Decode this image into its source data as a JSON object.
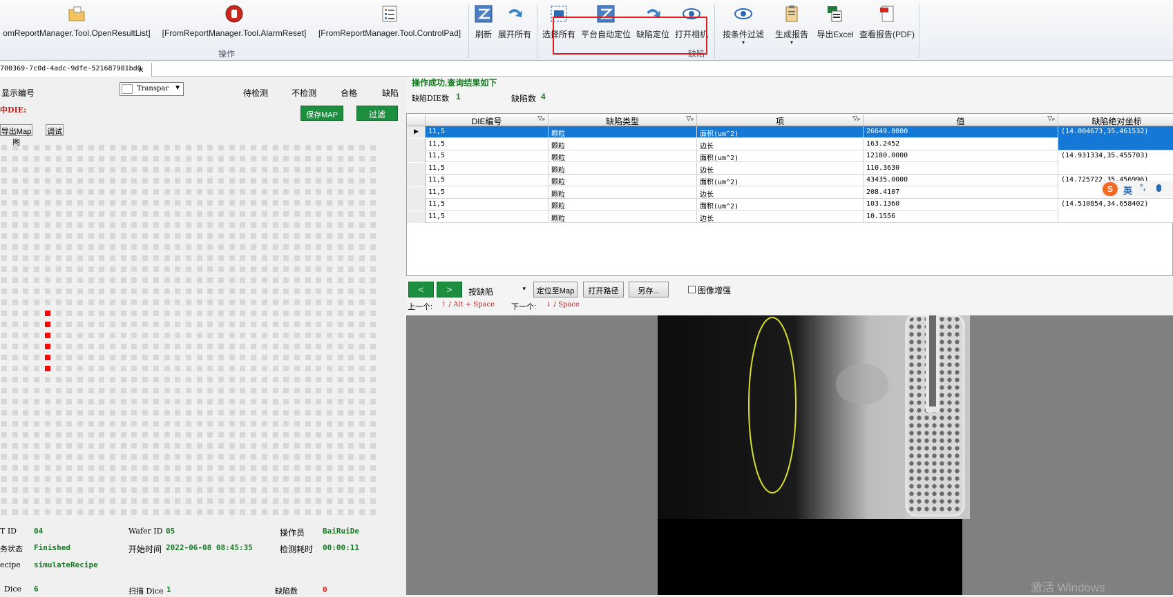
{
  "ribbon": {
    "items": [
      {
        "label": "omReportManager.Tool.OpenResultList]",
        "icon": "folder-icon"
      },
      {
        "label": "[FromReportManager.Tool.AlarmReset]",
        "icon": "stop-hand-icon"
      },
      {
        "label": "[FromReportManager.Tool.ControlPad]",
        "icon": "list-icon"
      },
      {
        "label": "刷新",
        "icon": "refresh-icon"
      },
      {
        "label": "展开所有",
        "icon": "expand-arrow-icon"
      },
      {
        "label": "选择所有",
        "icon": "select-all-icon"
      },
      {
        "label": "平台自动定位",
        "icon": "auto-locate-icon"
      },
      {
        "label": "缺陷定位",
        "icon": "defect-locate-icon"
      },
      {
        "label": "打开相机",
        "icon": "camera-eye-icon"
      },
      {
        "label": "按条件过滤",
        "icon": "filter-eye-icon"
      },
      {
        "label": "生成报告",
        "icon": "clipboard-icon"
      },
      {
        "label": "导出Excel",
        "icon": "excel-icon"
      },
      {
        "label": "查看报告(PDF)",
        "icon": "pdf-icon"
      }
    ],
    "group_operate": "操作",
    "group_defect": "缺陷"
  },
  "tab": {
    "title": "700369-7c0d-4adc-9dfe-521687981bd0",
    "close": "✕"
  },
  "left": {
    "show_number": "显示编号",
    "transparency": "Transpar",
    "legend": [
      "待检测",
      "不检测",
      "合格",
      "缺陷"
    ],
    "selected_die": "中DIE:",
    "save_map": "保存MAP",
    "filter": "过滤",
    "export_map": "导出Map图",
    "debug": "调试",
    "info": {
      "lot_id_label": "T ID",
      "lot_id": "04",
      "wafer_id_label": "Wafer ID",
      "wafer_id": "05",
      "operator_label": "操作员",
      "operator": "BaiRuiDe",
      "status_label": "务状态",
      "status": "Finished",
      "start_label": "开始时间",
      "start": "2022-06-08 08:45:35",
      "elapsed_label": "检测耗时",
      "elapsed": "00:00:11",
      "recipe_label": "ecipe",
      "recipe": "simulateRecipe",
      "dice_label": "Dice",
      "dice": "6",
      "scan_label": "扫描 Dice",
      "scan": "1",
      "defects_label": "缺陷数",
      "defects": "0"
    }
  },
  "right": {
    "message": "操作成功,查询结果如下",
    "defect_die_label": "缺陷DIE数",
    "defect_die": "1",
    "defect_count_label": "缺陷数",
    "defect_count": "4",
    "columns": [
      "DIE编号",
      "缺陷类型",
      "项",
      "值",
      "缺陷绝对坐标"
    ],
    "rows": [
      [
        "11,5",
        "颗粒",
        "面积(um^2)",
        "26649.0000",
        "(14.004673,35.461532)"
      ],
      [
        "11,5",
        "颗粒",
        "边长",
        "163.2452",
        ""
      ],
      [
        "11,5",
        "颗粒",
        "面积(um^2)",
        "12180.0000",
        "(14.931334,35.455703)"
      ],
      [
        "11,5",
        "颗粒",
        "边长",
        "110.3630",
        ""
      ],
      [
        "11,5",
        "颗粒",
        "面积(um^2)",
        "43435.0000",
        "(14.725722,35.456996)"
      ],
      [
        "11,5",
        "颗粒",
        "边长",
        "208.4107",
        ""
      ],
      [
        "11,5",
        "颗粒",
        "面积(um^2)",
        "103.1360",
        "(14.510854,34.658402)"
      ],
      [
        "11,5",
        "颗粒",
        "边长",
        "10.1556",
        ""
      ]
    ],
    "nav_prev": "<",
    "nav_next": ">",
    "mode": "按缺陷",
    "locate_map": "定位至Map",
    "open_path": "打开路径",
    "save_as": "另存...",
    "enhance": "图像增强",
    "prev_hint_label": "上一个:",
    "prev_hint_key": "↑ / Alt + Space",
    "next_hint_label": "下一个:",
    "next_hint_key": "↓ / Space",
    "ime_label": "英",
    "watermark": "激活 Windows"
  },
  "colors": {
    "accent": "#1378d6",
    "ok_green": "#157a22",
    "highlight_red": "#e21b1b"
  }
}
